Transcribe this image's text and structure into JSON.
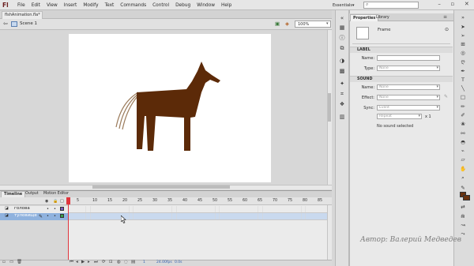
{
  "app": {
    "logo": "Fl",
    "workspace": "Essentials",
    "search_placeholder": ""
  },
  "menu": [
    "File",
    "Edit",
    "View",
    "Insert",
    "Modify",
    "Text",
    "Commands",
    "Control",
    "Debug",
    "Window",
    "Help"
  ],
  "document": {
    "tab": "flshAnimation.fla*",
    "scene": "Scene 1",
    "zoom": "100%"
  },
  "colors": {
    "horse": "#5c2a08",
    "tail": "#9a7a5a",
    "stroke": "#6a3310",
    "fill": "#6a3310",
    "onion_frame": "#e0353d"
  },
  "timeline": {
    "tabs": [
      "Timeline",
      "Output",
      "Motion Editor"
    ],
    "frame_numbers": [
      "5",
      "10",
      "15",
      "20",
      "25",
      "30",
      "35",
      "40",
      "45",
      "50",
      "55",
      "60",
      "65",
      "70",
      "75",
      "80",
      "85"
    ],
    "layers": [
      {
        "name": "голова",
        "selected": false
      },
      {
        "name": "туловище",
        "selected": true
      }
    ],
    "status": {
      "current_frame": "1",
      "fps": "24.00fps",
      "time": "0.0s"
    }
  },
  "properties": {
    "tabs": [
      "Properties",
      "Library"
    ],
    "frame_label": "Frame",
    "label_section": "LABEL",
    "name_label": "Name:",
    "name_value": "",
    "type_label": "Type:",
    "type_value": "None",
    "sound_section": "SOUND",
    "sound_name_label": "Name:",
    "sound_name_value": "None",
    "effect_label": "Effect:",
    "effect_value": "None",
    "sync_label": "Sync:",
    "sync_value": "Event",
    "repeat_value": "Repeat",
    "repeat_count": "x 1",
    "no_sound": "No sound selected"
  },
  "watermark": "Автор: Валерий Медведев"
}
